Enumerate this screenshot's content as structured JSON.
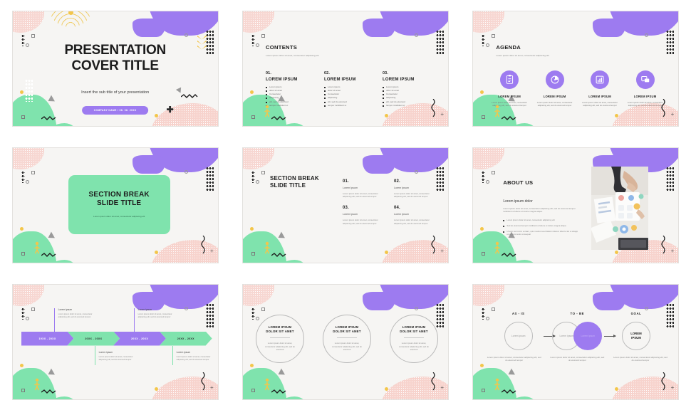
{
  "theme": {
    "purple": "#9d7bf0",
    "green": "#7fe3ad",
    "pink": "#f7d3cd",
    "yellow": "#f3c64b",
    "ink": "#1c1c1c",
    "slide_bg": "#f6f5f3"
  },
  "slides": [
    {
      "id": "cover",
      "name": "presentation-cover-slide",
      "title_line1": "PRESENTATION",
      "title_line2": "COVER TITLE",
      "subtitle": "Insert the sub title of your presentation",
      "button_label": "COMPANY NAME / 08. 06. 20XX"
    },
    {
      "id": "contents",
      "name": "contents-slide",
      "heading": "CONTENTS",
      "subheading": "Lorem ipsum dolor sit amet, consectetur adipiscing elit",
      "columns": [
        {
          "number": "01.",
          "title": "LOREM IPSUM",
          "items": [
            "Lorem ipsum",
            "dolor sit amet",
            "Consectetur",
            "adipiscing",
            "elit, sed do eiusmod",
            "tempor incididunt ut"
          ]
        },
        {
          "number": "02.",
          "title": "LOREM IPSUM",
          "items": [
            "Lorem ipsum",
            "dolor sit amet",
            "Consectetur",
            "adipiscing",
            "elit, sed do eiusmod",
            "tempor incididunt ut"
          ]
        },
        {
          "number": "03.",
          "title": "LOREM IPSUM",
          "items": [
            "Lorem ipsum",
            "dolor sit amet",
            "Consectetur",
            "adipiscing",
            "elit, sed do eiusmod",
            "tempor incididunt ut"
          ]
        }
      ]
    },
    {
      "id": "agenda",
      "name": "agenda-slide",
      "heading": "AGENDA",
      "subheading": "Lorem ipsum dolor sit amet, consectetur adipiscing elit",
      "items": [
        {
          "icon": "clipboard-icon",
          "label": "LOREM IPSUM",
          "text": "Lorem ipsum dolor sit amet, consectetur adipiscing elit, sed do eiusmod tempor"
        },
        {
          "icon": "pie-chart-icon",
          "label": "LOREM IPSUM",
          "text": "Lorem ipsum dolor sit amet, consectetur adipiscing elit, sed do eiusmod tempor"
        },
        {
          "icon": "bar-chart-icon",
          "label": "LOREM IPSUM",
          "text": "Lorem ipsum dolor sit amet, consectetur adipiscing elit, sed do eiusmod tempor"
        },
        {
          "icon": "chat-icon",
          "label": "LOREM IPSUM",
          "text": "Lorem ipsum dolor sit amet, consectetur adipiscing elit, sed do eiusmod tempor"
        }
      ]
    },
    {
      "id": "section-break",
      "name": "section-break-slide",
      "title_line1": "SECTION BREAK",
      "title_line2": "SLIDE TITLE",
      "subtitle": "Lorem ipsum dolor sit amet, consectetur adipiscing elit"
    },
    {
      "id": "section-break-list",
      "name": "section-break-list-slide",
      "title_line1": "SECTION BREAK",
      "title_line2": "SLIDE TITLE",
      "items": [
        {
          "number": "01.",
          "subtitle": "Lorem Ipsum",
          "text": "Lorem ipsum dolor sit amet, consectetur adipiscing elit, sed do eiusmod tempor"
        },
        {
          "number": "02.",
          "subtitle": "Lorem Ipsum",
          "text": "Lorem ipsum dolor sit amet, consectetur adipiscing elit, sed do eiusmod tempor"
        },
        {
          "number": "03.",
          "subtitle": "Lorem Ipsum",
          "text": "Lorem ipsum dolor sit amet, consectetur adipiscing elit, sed do eiusmod tempor"
        },
        {
          "number": "04.",
          "subtitle": "Lorem Ipsum",
          "text": "Lorem ipsum dolor sit amet, consectetur adipiscing elit, sed do eiusmod tempor"
        }
      ]
    },
    {
      "id": "about-us",
      "name": "about-us-slide",
      "heading": "ABOUT US",
      "lead": "Lorem ipsum dolor",
      "paragraph": "Lorem ipsum dolor sit amet, consectetur adipiscing elit, sed do eiusmod tempor incididunt ut labore et dolore magna aliqua.",
      "bullets": [
        "Lorem ipsum dolor sit amet, consectetur adipiscing elit",
        "Sed do eiusmod tempor incididunt ut labore et dolore magna aliqua",
        "Ut enim ad minim veniam, quis nostrud exercitation ullamco laboris nisi ut aliquip ex ea commodo consequat"
      ],
      "photo_alt": "business-team-reviewing-charts-photo"
    },
    {
      "id": "timeline",
      "name": "timeline-slide",
      "steps": [
        {
          "label": "19XX - 20XX",
          "color": "purple"
        },
        {
          "label": "20XX - 20XX",
          "color": "green"
        },
        {
          "label": "20XX - 20XX",
          "color": "purple"
        },
        {
          "label": "20XX - 20XX",
          "color": "green"
        }
      ],
      "notes": [
        {
          "title": "Lorem ipsum",
          "text": "Lorem ipsum dolor sit amet, consectetur adipiscing elit, sed do eiusmod tempor",
          "position": "top"
        },
        {
          "title": "Lorem ipsum",
          "text": "Lorem ipsum dolor sit amet, consectetur adipiscing elit, sed do eiusmod tempor",
          "position": "bottom"
        },
        {
          "title": "Lorem ipsum",
          "text": "Lorem ipsum dolor sit amet, consectetur adipiscing elit, sed do eiusmod tempor",
          "position": "top"
        },
        {
          "title": "Lorem ipsum",
          "text": "Lorem ipsum dolor sit amet, consectetur adipiscing elit, sed do eiusmod tempor",
          "position": "bottom"
        }
      ]
    },
    {
      "id": "circles",
      "name": "three-circles-slide",
      "items": [
        {
          "title_line1": "LOREM IPSUM",
          "title_line2": "DOLOR SIT AMET",
          "text": "Lorem ipsum dolor sit amet, consectetur adipiscing elit, sed do eiusmod"
        },
        {
          "title_line1": "LOREM IPSUM",
          "title_line2": "DOLOR SIT AMET",
          "text": "Lorem ipsum dolor sit amet, consectetur adipiscing elit, sed do eiusmod"
        },
        {
          "title_line1": "LOREM IPSUM",
          "title_line2": "DOLOR SIT AMET",
          "text": "Lorem ipsum dolor sit amet, consectetur adipiscing elit, sed do eiusmod"
        }
      ]
    },
    {
      "id": "as-is-to-be",
      "name": "as-is-to-be-goal-slide",
      "stages": [
        {
          "head": "AS - IS",
          "circle_label": "Lorem ipsum",
          "text": "Lorem ipsum dolor sit amet, consectetur adipiscing elit, sed do eiusmod tempor"
        },
        {
          "head": "TO - BE",
          "circle_label": "Lorem ipsum",
          "circle_label_alt": "Lorem ipsum",
          "text": "Lorem ipsum dolor sit amet, consectetur adipiscing elit, sed do eiusmod tempor"
        },
        {
          "head": "GOAL",
          "circle_label_line1": "LOREM",
          "circle_label_line2": "IPSUM",
          "text": "Lorem ipsum dolor sit amet, consectetur adipiscing elit, sed do eiusmod tempor"
        }
      ]
    }
  ]
}
